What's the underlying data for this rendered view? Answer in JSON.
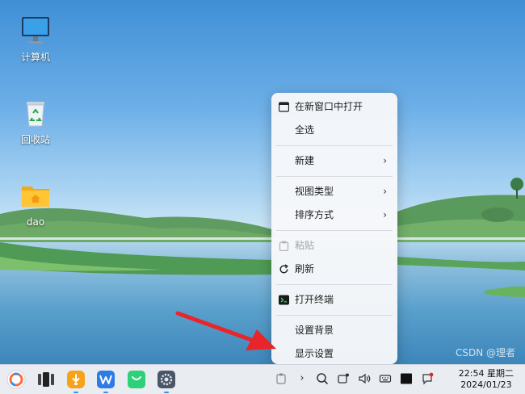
{
  "desktop": {
    "icons": [
      {
        "label": "计算机"
      },
      {
        "label": "回收站"
      },
      {
        "label": "dao"
      }
    ]
  },
  "context_menu": {
    "items": [
      {
        "label": "在新窗口中打开"
      },
      {
        "label": "全选"
      },
      {
        "label": "新建"
      },
      {
        "label": "视图类型"
      },
      {
        "label": "排序方式"
      },
      {
        "label": "粘贴"
      },
      {
        "label": "刷新"
      },
      {
        "label": "打开终端"
      },
      {
        "label": "设置背景"
      },
      {
        "label": "显示设置"
      }
    ]
  },
  "taskbar": {
    "clock_time": "22:54 星期二",
    "clock_date": "2024/01/23",
    "watermark": "CSDN @理者"
  },
  "colors": {
    "accent": "#3a8ee6",
    "arrow": "#e8262a",
    "menu_bg": "#f7f8fa"
  }
}
